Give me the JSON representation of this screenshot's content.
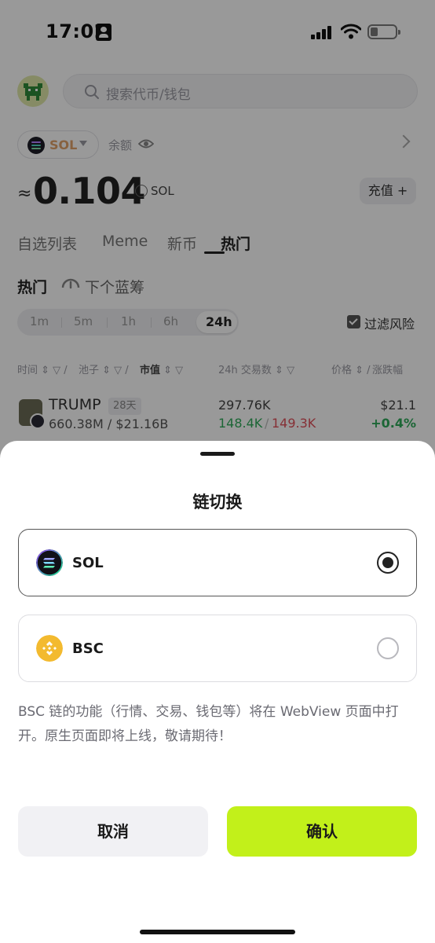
{
  "status_bar": {
    "time": "17:02"
  },
  "header": {
    "search_placeholder": "搜索代币/钱包"
  },
  "wallet": {
    "chain": "SOL",
    "balance_label": "余额",
    "approx_sign": "≈",
    "balance": "0.104",
    "unit": "SOL",
    "recharge": "充值 +"
  },
  "tabs": [
    "自选列表",
    "Meme",
    "新币",
    "热门"
  ],
  "section": {
    "hot": "热门",
    "next_blue_chip": "下个蓝筹"
  },
  "timeframes": [
    "1m",
    "5m",
    "1h",
    "6h",
    "24h"
  ],
  "filter_label": "过滤风险",
  "columns": {
    "time": "时间",
    "pool": "池子",
    "mcap": "市值",
    "tx": "24h 交易数",
    "price": "价格",
    "change": "涨跌幅"
  },
  "token_row": {
    "symbol": "TRUMP",
    "age": "28天",
    "mcap": "660.38M / $21.16B",
    "volume": "297.76K",
    "buys": "148.4K",
    "sells": "149.3K",
    "price": "$21.1",
    "change": "+0.4%"
  },
  "sheet": {
    "title": "链切换",
    "options": [
      {
        "label": "SOL",
        "selected": true
      },
      {
        "label": "BSC",
        "selected": false
      }
    ],
    "notice": "BSC 链的功能（行情、交易、钱包等）将在 WebView 页面中打开。原生页面即将上线，敬请期待！",
    "cancel": "取消",
    "confirm": "确认"
  },
  "colors": {
    "accent": "#c2f01a",
    "gain": "#2faa5a",
    "loss": "#e0505a",
    "bnb": "#f3ba2f"
  }
}
